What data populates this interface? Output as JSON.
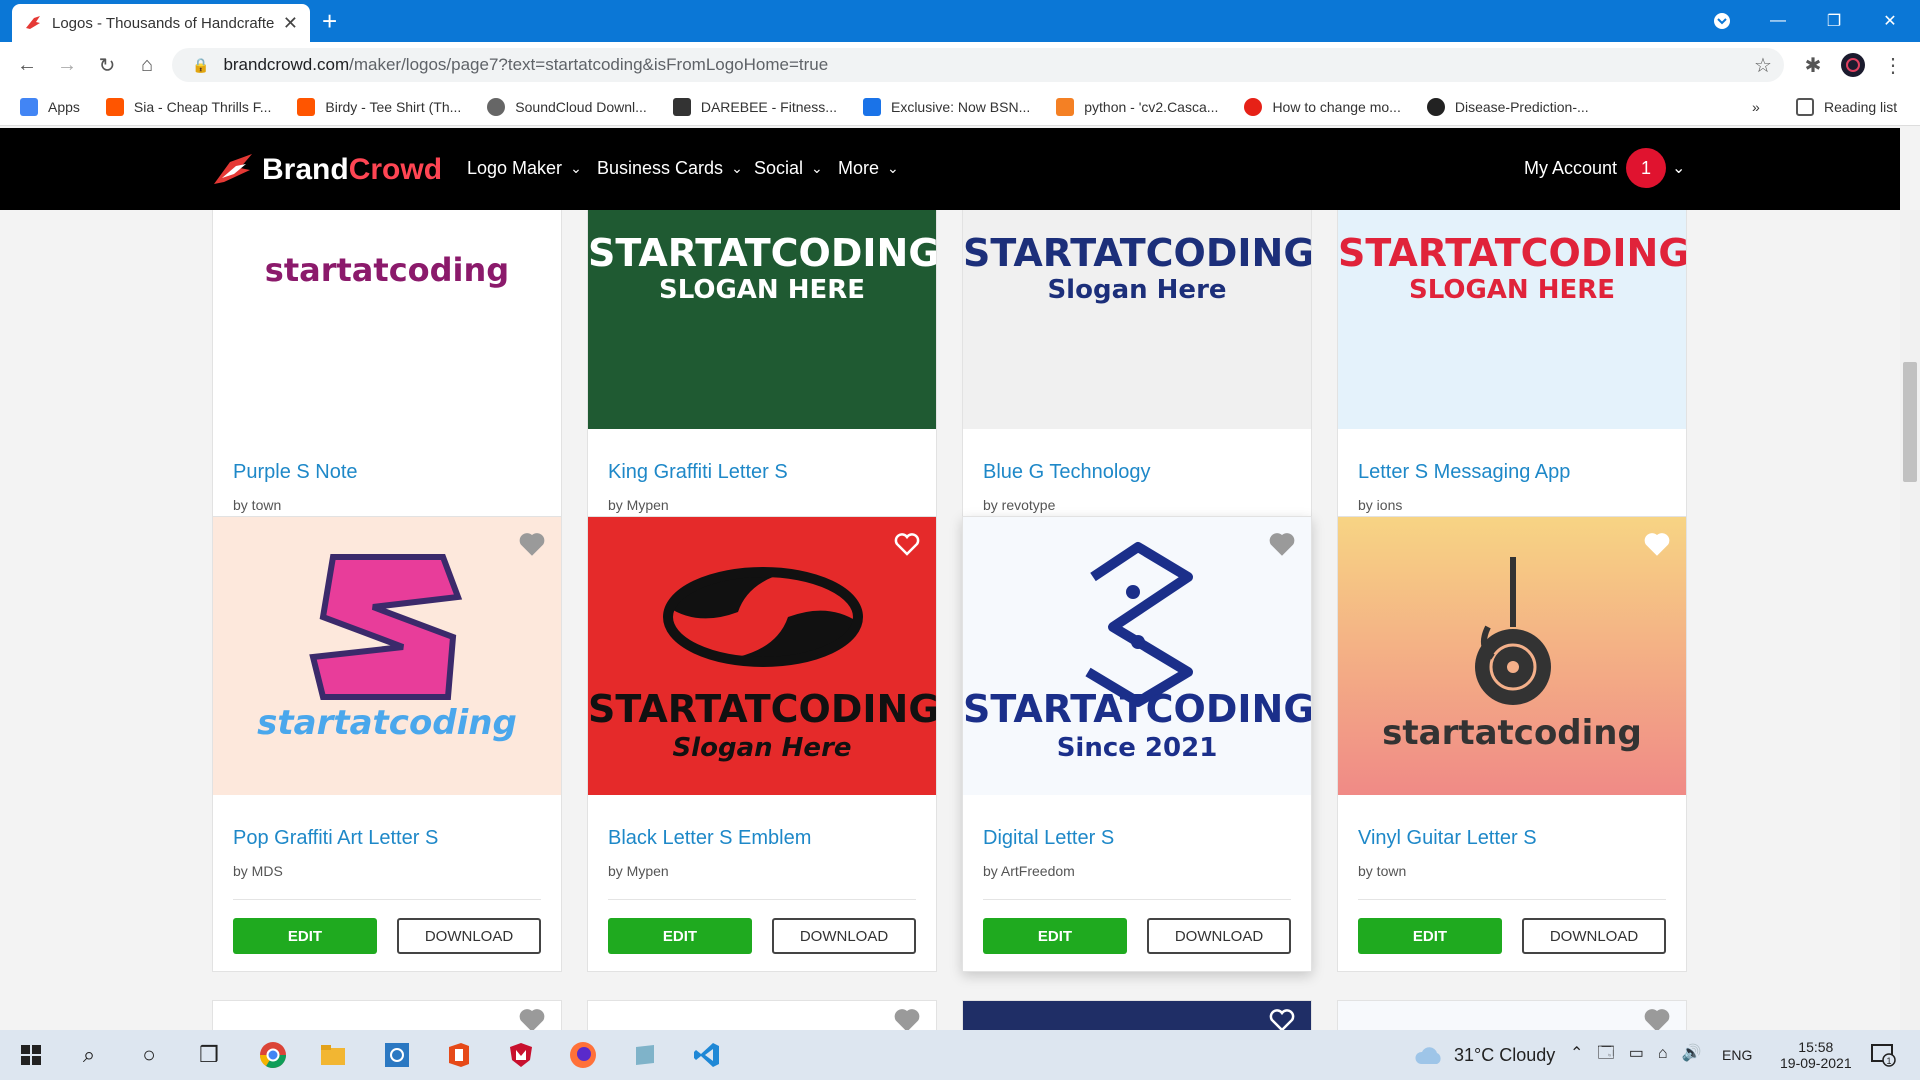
{
  "browser": {
    "tab_title": "Logos - Thousands of Handcrafte",
    "url_host": "brandcrowd.com",
    "url_path": "/maker/logos/page7?text=startatcoding&isFromLogoHome=true",
    "bookmarks": [
      {
        "label": "Apps",
        "icon": "apps-icon",
        "color": "#4285f4"
      },
      {
        "label": "Sia - Cheap Thrills F...",
        "icon": "soundcloud-icon",
        "color": "#ff5500"
      },
      {
        "label": "Birdy - Tee Shirt (Th...",
        "icon": "soundcloud-icon",
        "color": "#ff5500"
      },
      {
        "label": "SoundCloud Downl...",
        "icon": "globe-icon",
        "color": "#666666"
      },
      {
        "label": "DAREBEE - Fitness...",
        "icon": "darebee-icon",
        "color": "#333333"
      },
      {
        "label": "Exclusive: Now BSN...",
        "icon": "wifi-icon",
        "color": "#1a73e8"
      },
      {
        "label": "python - 'cv2.Casca...",
        "icon": "stackoverflow-icon",
        "color": "#f48024"
      },
      {
        "label": "How to change mo...",
        "icon": "in-icon",
        "color": "#e62117"
      },
      {
        "label": "Disease-Prediction-...",
        "icon": "github-icon",
        "color": "#222222"
      }
    ],
    "more_bookmarks": "»",
    "reading_list": "Reading list"
  },
  "site": {
    "brand_a": "Brand",
    "brand_b": "Crowd",
    "menu": [
      "Logo Maker",
      "Business Cards",
      "Social",
      "More"
    ],
    "account": "My Account",
    "notifications": "1"
  },
  "cards": [
    {
      "name": "Purple S Note",
      "author": "by town",
      "logo_text": "startatcoding",
      "logo_slogan": "",
      "bg": "#ffffff",
      "fg": "#8b1a6b"
    },
    {
      "name": "King Graffiti Letter S",
      "author": "by Mypen",
      "logo_text": "STARTATCODING",
      "logo_slogan": "SLOGAN HERE",
      "bg": "#1f5a32",
      "fg": "#ffffff"
    },
    {
      "name": "Blue G Technology",
      "author": "by revotype",
      "logo_text": "STARTATCODING",
      "logo_slogan": "Slogan Here",
      "bg": "#f0f0f0",
      "fg": "#1c2f7a"
    },
    {
      "name": "Letter S Messaging App",
      "author": "by ions",
      "logo_text": "STARTATCODING",
      "logo_slogan": "SLOGAN HERE",
      "bg": "#e4f2fb",
      "fg": "#e0233a"
    },
    {
      "name": "Pop Graffiti Art Letter S",
      "author": "by MDS",
      "logo_text": "startatcoding",
      "logo_slogan": "",
      "bg": "#fde8dc",
      "fg": "#e83d9a"
    },
    {
      "name": "Black Letter S Emblem",
      "author": "by Mypen",
      "logo_text": "STARTATCODING",
      "logo_slogan": "Slogan Here",
      "bg": "#e52a2a",
      "fg": "#111111"
    },
    {
      "name": "Digital Letter S",
      "author": "by ArtFreedom",
      "logo_text": "STARTATCODING",
      "logo_slogan": "Since 2021",
      "bg": "#f6f9fd",
      "fg": "#1b2f8a"
    },
    {
      "name": "Vinyl Guitar Letter S",
      "author": "by town",
      "logo_text": "startatcoding",
      "logo_slogan": "",
      "bg": "#f4a882",
      "fg": "#333333"
    }
  ],
  "buttons": {
    "edit": "EDIT",
    "download": "DOWNLOAD"
  },
  "taskbar": {
    "weather": "31°C  Cloudy",
    "lang": "ENG",
    "time": "15:58",
    "date": "19-09-2021",
    "notif_count": "1"
  }
}
